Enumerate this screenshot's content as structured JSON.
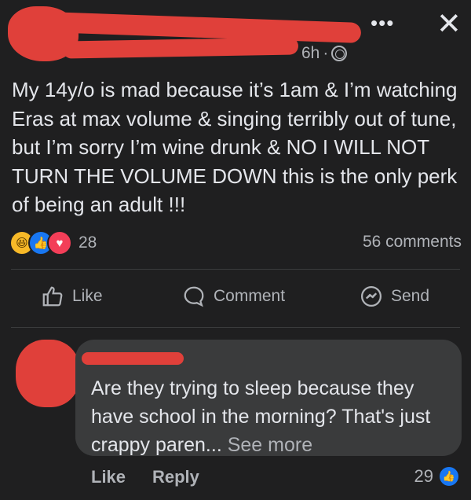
{
  "post": {
    "time": "6h",
    "time_separator": "·",
    "more_icon": "more-dots-icon",
    "close_icon": "close-icon",
    "privacy_icon": "friends-icon",
    "text": "My 14y/o is mad because it’s 1am & I’m watching Eras at max volume & singing terribly out of tune, but I’m sorry I’m wine drunk & NO I WILL NOT TURN THE VOLUME DOWN this is the only perk of being an adult !!!"
  },
  "stats": {
    "reaction_count": "28",
    "comments": "56 comments",
    "reactions": [
      "haha",
      "like",
      "love"
    ]
  },
  "actions": {
    "like": "Like",
    "comment": "Comment",
    "send": "Send"
  },
  "comment": {
    "text": "Are they trying to sleep because they have school in the morning? That's just crappy paren...",
    "see_more": "See more",
    "like": "Like",
    "reply": "Reply",
    "likes": "29"
  },
  "colors": {
    "background": "#1f1f20",
    "redaction": "#e0403a",
    "bubble": "#3a3b3c",
    "secondary_text": "#b0b3b8"
  }
}
